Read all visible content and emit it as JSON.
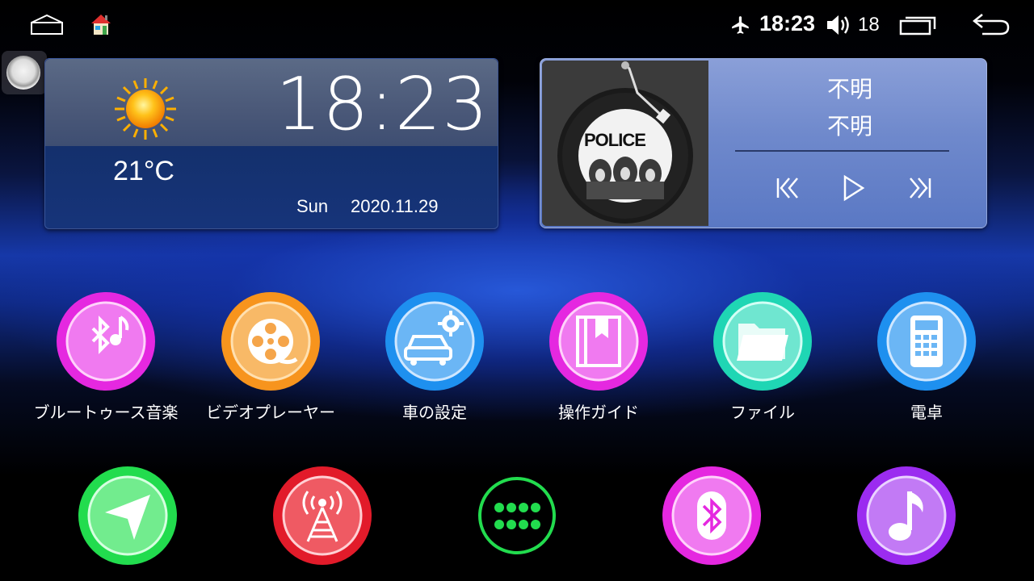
{
  "status_bar": {
    "time": "18:23",
    "volume": "18",
    "icons": [
      "home-outline-icon",
      "house-app-icon",
      "airplane-icon",
      "volume-icon",
      "recent-apps-icon",
      "back-arrow-icon"
    ]
  },
  "clock_widget": {
    "time": "18:23",
    "temperature": "21°C",
    "day": "Sun",
    "date": "2020.11.29",
    "weather_icon": "sun-icon"
  },
  "music_widget": {
    "title": "不明",
    "artist": "不明",
    "album_text": "POLICE",
    "controls": [
      "previous-icon",
      "play-icon",
      "next-icon"
    ]
  },
  "apps": [
    {
      "label": "ブルートゥース音楽",
      "icon": "bluetooth-music-icon",
      "color": "#e528e0"
    },
    {
      "label": "ビデオプレーヤー",
      "icon": "film-reel-icon",
      "color": "#f7941d"
    },
    {
      "label": "車の設定",
      "icon": "car-settings-icon",
      "color": "#1e90ef"
    },
    {
      "label": "操作ガイド",
      "icon": "guide-book-icon",
      "color": "#e528e0"
    },
    {
      "label": "ファイル",
      "icon": "folder-icon",
      "color": "#1fd6b4"
    },
    {
      "label": "電卓",
      "icon": "calculator-icon",
      "color": "#1e90ef"
    }
  ],
  "dock": [
    {
      "icon": "navigation-icon",
      "color": "#22dc4e"
    },
    {
      "icon": "radio-tower-icon",
      "color": "#e21b2a"
    },
    {
      "icon": "app-drawer-icon",
      "color": "#22dc4e"
    },
    {
      "icon": "bluetooth-icon",
      "color": "#e528e0"
    },
    {
      "icon": "music-note-icon",
      "color": "#9b2cf0"
    }
  ]
}
